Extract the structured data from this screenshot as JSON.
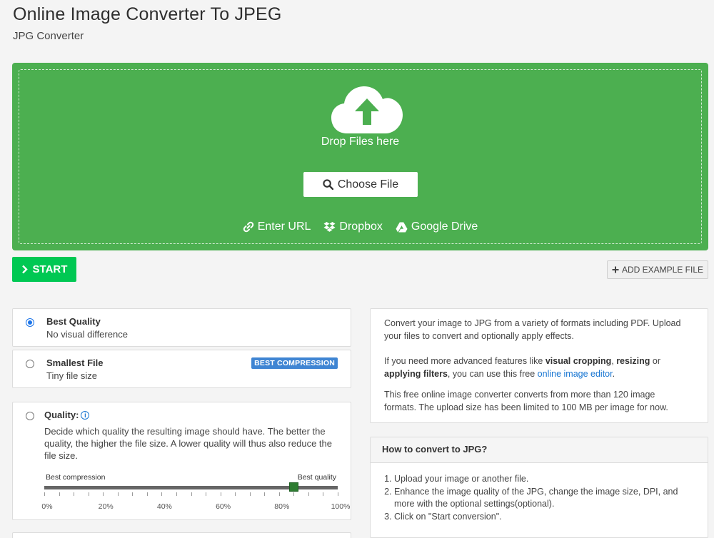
{
  "header": {
    "title": "Online Image Converter To JPEG",
    "subtitle": "JPG Converter"
  },
  "upload": {
    "drop_text": "Drop Files here",
    "choose_label": "Choose File",
    "sources": [
      {
        "label": "Enter URL",
        "icon": "link-icon"
      },
      {
        "label": "Dropbox",
        "icon": "dropbox-icon"
      },
      {
        "label": "Google Drive",
        "icon": "google-drive-icon"
      }
    ],
    "color": "#4caf50"
  },
  "actions": {
    "start_label": "START",
    "example_label": "ADD EXAMPLE FILE",
    "start_color": "#00c853"
  },
  "options": {
    "best_quality": {
      "title": "Best Quality",
      "desc": "No visual difference",
      "selected": true
    },
    "smallest_file": {
      "title": "Smallest File",
      "desc": "Tiny file size",
      "badge": "BEST COMPRESSION"
    },
    "quality": {
      "title": "Quality:",
      "desc": "Decide which quality the resulting image should have. The better the quality, the higher the file size. A lower quality will thus also reduce the file size.",
      "min_label": "Best compression",
      "max_label": "Best quality",
      "value_percent": 85,
      "ticks": [
        "0%",
        "20%",
        "40%",
        "60%",
        "80%",
        "100%"
      ]
    }
  },
  "info": {
    "p1": "Convert your image to JPG from a variety of formats including PDF. Upload your files to convert and optionally apply effects.",
    "p2_a": "If you need more advanced features like ",
    "p2_b1": "visual cropping",
    "p2_c": ", ",
    "p2_b2": "resizing",
    "p2_d": " or ",
    "p2_b3": "applying filters",
    "p2_e": ", you can use this free ",
    "p2_link": "online image editor",
    "p2_f": ".",
    "p3": "This free online image converter converts from more than 120 image formats. The upload size has been limited to 100 MB per image for now."
  },
  "howto": {
    "title": "How to convert to JPG?",
    "steps": [
      "Upload your image or another file.",
      "Enhance the image quality of the JPG, change the image size, DPI, and more with the optional settings(optional).",
      "Click on \"Start conversion\"."
    ]
  }
}
